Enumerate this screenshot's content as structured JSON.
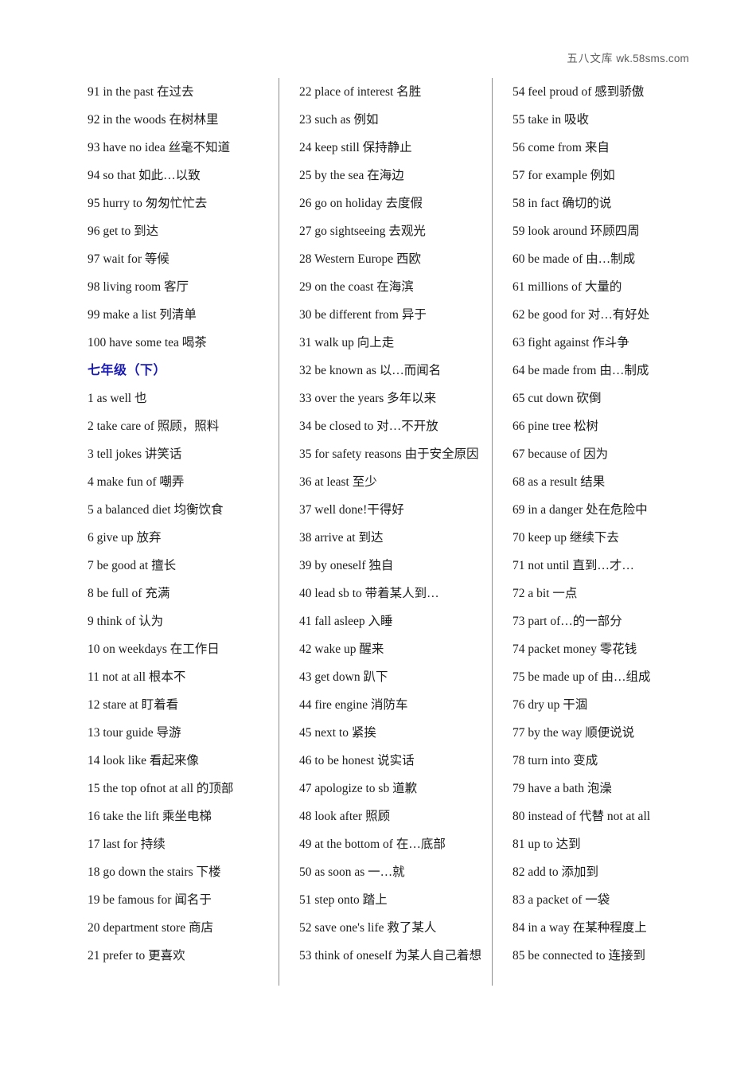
{
  "watermark": {
    "cn": "五八文库",
    "url": "wk.58sms.com"
  },
  "columns": [
    {
      "name": "column-1",
      "entries": [
        {
          "type": "entry",
          "text": "91 in the past 在过去"
        },
        {
          "type": "entry",
          "text": "92 in the woods 在树林里"
        },
        {
          "type": "entry",
          "text": "93 have no idea 丝毫不知道"
        },
        {
          "type": "entry",
          "text": "94 so that 如此…以致"
        },
        {
          "type": "entry",
          "text": "95 hurry to 匆匆忙忙去"
        },
        {
          "type": "entry",
          "text": "96 get to 到达"
        },
        {
          "type": "entry",
          "text": "97 wait for 等候"
        },
        {
          "type": "entry",
          "text": "98 living room 客厅"
        },
        {
          "type": "entry",
          "text": "99 make a list 列清单"
        },
        {
          "type": "entry",
          "text": "100 have some tea 喝茶"
        },
        {
          "type": "heading",
          "text": "七年级（下）"
        },
        {
          "type": "entry",
          "text": "1 as well 也"
        },
        {
          "type": "entry",
          "text": "2 take care of 照顾，照料"
        },
        {
          "type": "entry",
          "text": "3 tell jokes 讲笑话"
        },
        {
          "type": "entry",
          "text": "4 make fun of 嘲弄"
        },
        {
          "type": "entry",
          "text": "5 a balanced diet 均衡饮食"
        },
        {
          "type": "entry",
          "text": "6 give up 放弃"
        },
        {
          "type": "entry",
          "text": "7 be good at 擅长"
        },
        {
          "type": "entry",
          "text": "8 be full of 充满"
        },
        {
          "type": "entry",
          "text": "9 think of 认为"
        },
        {
          "type": "entry",
          "text": "10 on weekdays 在工作日"
        },
        {
          "type": "entry",
          "text": "11 not at all 根本不"
        },
        {
          "type": "entry",
          "text": "12 stare at 盯着看"
        },
        {
          "type": "entry",
          "text": "13 tour guide 导游"
        },
        {
          "type": "entry",
          "text": "14 look like 看起来像"
        },
        {
          "type": "entry",
          "text": "15 the top ofnot at all 的顶部"
        },
        {
          "type": "entry",
          "text": "16 take the lift 乘坐电梯"
        },
        {
          "type": "entry",
          "text": "17 last for 持续"
        },
        {
          "type": "entry",
          "text": "18 go down the stairs 下楼"
        },
        {
          "type": "entry",
          "text": "19 be famous for 闻名于"
        },
        {
          "type": "entry",
          "text": "20 department store 商店"
        },
        {
          "type": "entry",
          "text": "21 prefer to 更喜欢"
        }
      ]
    },
    {
      "name": "column-2",
      "entries": [
        {
          "type": "entry",
          "text": "22 place of interest 名胜"
        },
        {
          "type": "entry",
          "text": "23 such as 例如"
        },
        {
          "type": "entry",
          "text": "24 keep still 保持静止"
        },
        {
          "type": "entry",
          "text": "25 by the sea 在海边"
        },
        {
          "type": "entry",
          "text": "26 go on holiday 去度假"
        },
        {
          "type": "entry",
          "text": "27 go sightseeing 去观光"
        },
        {
          "type": "entry",
          "text": "28 Western Europe 西欧"
        },
        {
          "type": "entry",
          "text": "29 on the coast 在海滨"
        },
        {
          "type": "entry",
          "text": "30 be different from 异于"
        },
        {
          "type": "entry",
          "text": "31 walk up 向上走"
        },
        {
          "type": "entry",
          "text": "32 be known as 以…而闻名"
        },
        {
          "type": "entry",
          "text": "33 over the years 多年以来"
        },
        {
          "type": "entry",
          "text": "34 be closed to 对…不开放"
        },
        {
          "type": "entry",
          "text": "35 for safety reasons 由于安全原因"
        },
        {
          "type": "entry",
          "text": "36 at least 至少"
        },
        {
          "type": "entry",
          "text": "37 well done!干得好"
        },
        {
          "type": "entry",
          "text": "38 arrive at 到达"
        },
        {
          "type": "entry",
          "text": "39 by oneself 独自"
        },
        {
          "type": "entry",
          "text": "40 lead sb to 带着某人到…"
        },
        {
          "type": "entry",
          "text": "41 fall asleep 入睡"
        },
        {
          "type": "entry",
          "text": "42 wake up 醒来"
        },
        {
          "type": "entry",
          "text": "43 get down 趴下"
        },
        {
          "type": "entry",
          "text": "44 fire engine 消防车"
        },
        {
          "type": "entry",
          "text": "45 next to 紧挨"
        },
        {
          "type": "entry",
          "text": "46 to be honest 说实话"
        },
        {
          "type": "entry",
          "text": "47 apologize to sb 道歉"
        },
        {
          "type": "entry",
          "text": "48 look after 照顾"
        },
        {
          "type": "entry",
          "text": "49 at the bottom of 在…底部"
        },
        {
          "type": "entry",
          "text": "50 as soon as 一…就"
        },
        {
          "type": "entry",
          "text": "51 step onto 踏上"
        },
        {
          "type": "entry",
          "text": "52 save one's life 救了某人"
        },
        {
          "type": "entry",
          "text": "53 think of oneself 为某人自己着想"
        }
      ]
    },
    {
      "name": "column-3",
      "entries": [
        {
          "type": "entry",
          "text": "54 feel proud of 感到骄傲"
        },
        {
          "type": "entry",
          "text": "55 take in 吸收"
        },
        {
          "type": "entry",
          "text": "56 come from 来自"
        },
        {
          "type": "entry",
          "text": "57 for example 例如"
        },
        {
          "type": "entry",
          "text": "58 in fact 确切的说"
        },
        {
          "type": "entry",
          "text": "59 look around 环顾四周"
        },
        {
          "type": "entry",
          "text": "60 be made of 由…制成"
        },
        {
          "type": "entry",
          "text": "61 millions of 大量的"
        },
        {
          "type": "entry",
          "text": "62 be good for 对…有好处"
        },
        {
          "type": "entry",
          "text": "63 fight against 作斗争"
        },
        {
          "type": "entry",
          "text": "64 be made from 由…制成"
        },
        {
          "type": "entry",
          "text": "65 cut down 砍倒"
        },
        {
          "type": "entry",
          "text": "66 pine tree 松树"
        },
        {
          "type": "entry",
          "text": "67 because of 因为"
        },
        {
          "type": "entry",
          "text": "68 as a result 结果"
        },
        {
          "type": "entry",
          "text": "69 in a danger 处在危险中"
        },
        {
          "type": "entry",
          "text": "70 keep up 继续下去"
        },
        {
          "type": "entry",
          "text": "71 not until 直到…才…"
        },
        {
          "type": "entry",
          "text": "72 a bit 一点"
        },
        {
          "type": "entry",
          "text": "73 part of…的一部分"
        },
        {
          "type": "entry",
          "text": "74 packet money 零花钱"
        },
        {
          "type": "entry",
          "text": "75 be made up of 由…组成"
        },
        {
          "type": "entry",
          "text": "76 dry up 干涸"
        },
        {
          "type": "entry",
          "text": "77 by the way 顺便说说"
        },
        {
          "type": "entry",
          "text": "78 turn into 变成"
        },
        {
          "type": "entry",
          "text": "79 have a bath 泡澡"
        },
        {
          "type": "entry",
          "text": "80 instead of 代替 not at all"
        },
        {
          "type": "entry",
          "text": "81 up to 达到"
        },
        {
          "type": "entry",
          "text": "82 add to 添加到"
        },
        {
          "type": "entry",
          "text": "83 a packet of 一袋"
        },
        {
          "type": "entry",
          "text": "84 in a way 在某种程度上"
        },
        {
          "type": "entry",
          "text": "85 be connected to 连接到"
        }
      ]
    }
  ],
  "colors": {
    "heading": "#1a1ab4",
    "text": "#1c1c1c",
    "rule": "#8d8d8d",
    "watermark": "#5b5b5b",
    "background": "#ffffff"
  }
}
